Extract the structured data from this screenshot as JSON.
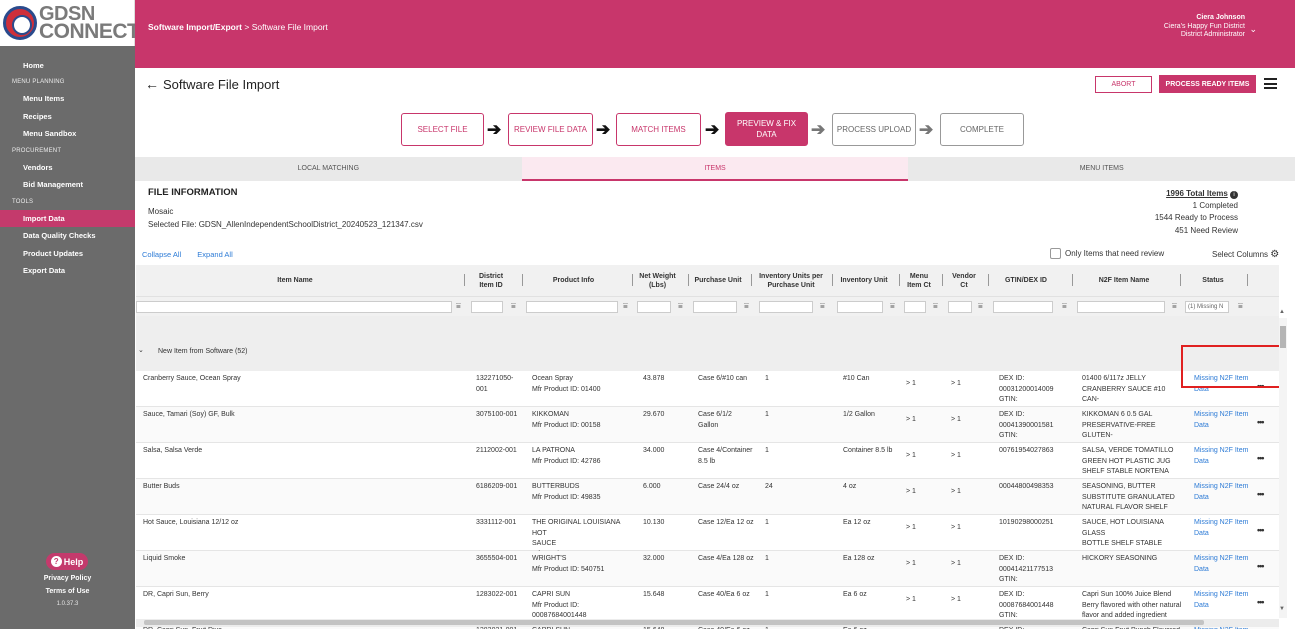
{
  "logo": {
    "line1": "GDSN",
    "line2": "CONNECT"
  },
  "sidebar": {
    "home": "Home",
    "section_menu": "MENU PLANNING",
    "menu_items": "Menu Items",
    "recipes": "Recipes",
    "menu_sandbox": "Menu Sandbox",
    "section_procurement": "PROCUREMENT",
    "vendors": "Vendors",
    "bid_management": "Bid Management",
    "section_tools": "TOOLS",
    "import_data": "Import Data",
    "data_quality": "Data Quality Checks",
    "product_updates": "Product Updates",
    "export_data": "Export Data",
    "help": "Help",
    "privacy": "Privacy Policy",
    "terms": "Terms of Use",
    "version": "1.0.37.3"
  },
  "header": {
    "crumb_parent": "Software Import/Export",
    "crumb_sep": ">",
    "crumb_current": "Software File Import",
    "user_name": "Ciera Johnson",
    "user_district": "Ciera's Happy Fun District",
    "user_role": "District Administrator"
  },
  "page": {
    "title": "Software File Import",
    "abort": "ABORT",
    "process": "PROCESS READY ITEMS"
  },
  "steps": {
    "s1": "SELECT FILE",
    "s2": "REVIEW FILE DATA",
    "s3": "MATCH ITEMS",
    "s4a": "PREVIEW & FIX",
    "s4b": "DATA",
    "s5": "PROCESS UPLOAD",
    "s6": "COMPLETE"
  },
  "tabs": {
    "local": "LOCAL MATCHING",
    "items": "ITEMS",
    "menu": "MENU ITEMS"
  },
  "file_info": {
    "title": "FILE INFORMATION",
    "vendor": "Mosaic",
    "selected_file": "Selected File: GDSN_AllenIndependentSchoolDistrict_20240523_121347.csv",
    "total": "1996 Total Items",
    "completed": "1 Completed",
    "ready": "1544 Ready to Process",
    "review": "451 Need Review"
  },
  "controls": {
    "collapse_all": "Collapse All",
    "expand_all": "Expand All",
    "only_review": "Only Items that need review",
    "select_columns": "Select Columns"
  },
  "columns": {
    "item_name": "Item Name",
    "district_id_1": "District",
    "district_id_2": "Item ID",
    "product_info": "Product Info",
    "net_weight_1": "Net Weight",
    "net_weight_2": "(Lbs)",
    "purchase_unit": "Purchase Unit",
    "inv_units_1": "Inventory Units per",
    "inv_units_2": "Purchase Unit",
    "inv_unit": "Inventory Unit",
    "menu_ct_1": "Menu",
    "menu_ct_2": "Item Ct",
    "vendor_ct_1": "Vendor",
    "vendor_ct_2": "Ct",
    "gtin": "GTIN/DEX ID",
    "n2f_name": "N2F Item Name",
    "status": "Status"
  },
  "status_filter": "(1) Missing N",
  "group_label": "New Item from Software (52)",
  "rows": [
    {
      "name": "Cranberry Sauce, Ocean Spray",
      "id1": "132271050-",
      "id2": "001",
      "p1": "Ocean Spray",
      "p2": "Mfr Product ID: 01400",
      "p3": "",
      "wt": "43.878",
      "pu1": "Case 6/#10 can",
      "pu2": "",
      "inv": "1",
      "iu": "#10 Can",
      "mc": "> 1",
      "vc": "> 1",
      "g1": "DEX ID:",
      "g2": "00031200014009",
      "g3": "GTIN:",
      "n1": "01400 6/117z JELLY",
      "n2": "CRANBERRY SAUCE #10 CAN-",
      "n3": "CA",
      "s1": "Missing N2F Item",
      "s2": "Data"
    },
    {
      "name": "Sauce, Tamari (Soy) GF, Bulk",
      "id1": "3075100-001",
      "id2": "",
      "p1": "KIKKOMAN",
      "p2": "Mfr Product ID: 00158",
      "p3": "",
      "wt": "29.670",
      "pu1": "Case 6/1/2",
      "pu2": "Gallon",
      "inv": "1",
      "iu": "1/2 Gallon",
      "mc": "> 1",
      "vc": "> 1",
      "g1": "DEX ID:",
      "g2": "00041390001581",
      "g3": "GTIN:",
      "n1": "KIKKOMAN 6 0.5 GAL",
      "n2": "PRESERVATIVE-FREE GLUTEN-",
      "n3": "FREE TAMARI SOY SAUCE",
      "s1": "Missing N2F Item",
      "s2": "Data"
    },
    {
      "name": "Salsa, Salsa Verde",
      "id1": "2112002-001",
      "id2": "",
      "p1": "LA PATRONA",
      "p2": "Mfr Product ID: 42786",
      "p3": "",
      "wt": "34.000",
      "pu1": "Case 4/Container",
      "pu2": "8.5 lb",
      "inv": "1",
      "iu": "Container 8.5 lb",
      "mc": "> 1",
      "vc": "> 1",
      "g1": "00761954027863",
      "g2": "",
      "g3": "",
      "n1": "SALSA, VERDE TOMATILLO",
      "n2": "GREEN HOT PLASTIC JUG",
      "n3": "SHELF STABLE NORTENA",
      "s1": "Missing N2F Item",
      "s2": "Data"
    },
    {
      "name": "Butter Buds",
      "id1": "6186209-001",
      "id2": "",
      "p1": "BUTTERBUDS",
      "p2": "Mfr Product ID: 49835",
      "p3": "",
      "wt": "6.000",
      "pu1": "Case 24/4 oz",
      "pu2": "",
      "inv": "24",
      "iu": "4 oz",
      "mc": "> 1",
      "vc": "> 1",
      "g1": "00044800498353",
      "g2": "",
      "g3": "",
      "n1": "SEASONING, BUTTER",
      "n2": "SUBSTITUTE GRANULATED",
      "n3": "NATURAL FLAVOR SHELF",
      "s1": "Missing N2F Item",
      "s2": "Data"
    },
    {
      "name": "Hot Sauce, Louisiana 12/12 oz",
      "id1": "3331112-001",
      "id2": "",
      "p1": "THE ORIGINAL LOUISIANA HOT",
      "p2": "SAUCE",
      "p3": "Mfr Product ID: 400015683",
      "wt": "10.130",
      "pu1": "Case 12/Ea 12 oz",
      "pu2": "",
      "inv": "1",
      "iu": "Ea 12 oz",
      "mc": "> 1",
      "vc": "> 1",
      "g1": "10190298000251",
      "g2": "",
      "g3": "",
      "n1": "SAUCE, HOT LOUISIANA GLASS",
      "n2": "BOTTLE SHELF STABLE",
      "n3": "",
      "s1": "Missing N2F Item",
      "s2": "Data"
    },
    {
      "name": "Liquid Smoke",
      "id1": "3655504-001",
      "id2": "",
      "p1": "WRIGHT'S",
      "p2": "Mfr Product ID: 540751",
      "p3": "",
      "wt": "32.000",
      "pu1": "Case 4/Ea 128 oz",
      "pu2": "",
      "inv": "1",
      "iu": "Ea 128 oz",
      "mc": "> 1",
      "vc": "> 1",
      "g1": "DEX ID:",
      "g2": "00041421177513",
      "g3": "GTIN:",
      "n1": "HICKORY SEASONING",
      "n2": "",
      "n3": "",
      "s1": "Missing N2F Item",
      "s2": "Data"
    },
    {
      "name": "DR, Capri Sun, Berry",
      "id1": "1283022-001",
      "id2": "",
      "p1": "CAPRI SUN",
      "p2": "Mfr Product ID:",
      "p3": "00087684001448",
      "wt": "15.648",
      "pu1": "Case 40/Ea 6 oz",
      "pu2": "",
      "inv": "1",
      "iu": "Ea 6 oz",
      "mc": "> 1",
      "vc": "> 1",
      "g1": "DEX ID:",
      "g2": "00087684001448",
      "g3": "GTIN:",
      "n1": "Capri Sun 100% Juice Blend",
      "n2": "Berry flavored with other natural",
      "n3": "flavor and added ingredient",
      "s1": "Missing N2F Item",
      "s2": "Data"
    },
    {
      "name": "DR, Capri Sun, Fruit Dive",
      "id1": "1283021-001",
      "id2": "",
      "p1": "CAPRI SUN",
      "p2": "",
      "p3": "",
      "wt": "15.648",
      "pu1": "Case 40/Ea 6 oz",
      "pu2": "",
      "inv": "1",
      "iu": "Ea 6 oz",
      "mc": "> 1",
      "vc": "> 1",
      "g1": "DEX ID:",
      "g2": "",
      "g3": "",
      "n1": "Capri Sun Fruit Punch Flavored",
      "n2": "",
      "n3": "",
      "s1": "Missing N2F Item",
      "s2": ""
    }
  ]
}
